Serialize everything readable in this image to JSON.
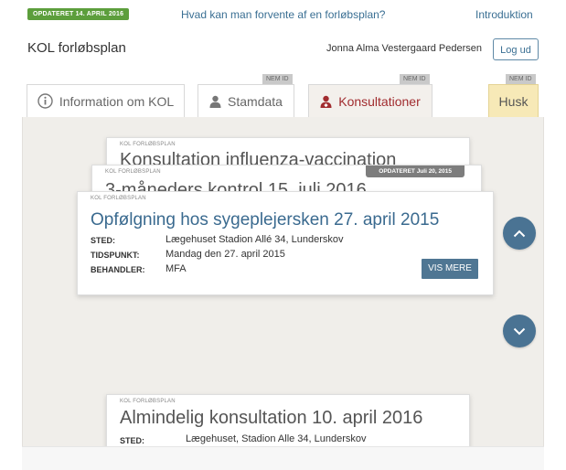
{
  "header": {
    "updated_badge": "OPDATERET 14. APRIL 2016",
    "question_link": "Hvad kan man forvente af en forløbsplan?",
    "intro_link": "Introduktion",
    "app_title": "KOL forløbsplan",
    "user_name": "Jonna Alma Vestergaard Pedersen",
    "logout_label": "Log ud"
  },
  "tabs": [
    {
      "label": "Information om KOL",
      "icon": "info-icon",
      "nemid": ""
    },
    {
      "label": "Stamdata",
      "icon": "person-icon",
      "nemid": "NEM ID"
    },
    {
      "label": "Konsultationer",
      "icon": "doctor-icon",
      "nemid": "NEM ID",
      "active": true
    },
    {
      "label": "Husk",
      "icon": "",
      "nemid": "NEM ID"
    }
  ],
  "cards": {
    "back1": {
      "tag": "KOL FORLØBSPLAN",
      "title": "Konsultation influenza-vaccination"
    },
    "back2": {
      "tag": "KOL FORLØBSPLAN",
      "title": "3-måneders kontrol 15. juli 2016",
      "updated": "OPDATERET Juli 20, 2015"
    },
    "main": {
      "tag": "KOL FORLØBSPLAN",
      "title": "Opfølgning hos sygeplejersken 27. april 2015",
      "rows": [
        {
          "label": "STED:",
          "value": "Lægehuset Stadion Allé 34, Lunderskov"
        },
        {
          "label": "TIDSPUNKT:",
          "value": "Mandag den 27. april 2015"
        },
        {
          "label": "BEHANDLER:",
          "value": "MFA"
        }
      ],
      "button": "VIS MERE"
    },
    "lower": {
      "tag": "KOL FORLØBSPLAN",
      "title": "Almindelig konsultation 10. april 2016",
      "rows": [
        {
          "label": "STED:",
          "value": "Lægehuset, Stadion Alle 34, Lunderskov"
        }
      ]
    }
  },
  "nav": {
    "up_icon": "chevron-up-icon",
    "down_icon": "chevron-down-icon"
  },
  "colors": {
    "accent": "#4a7393",
    "active_tab": "#a12c2f",
    "husk": "#f7e9b7",
    "updated_green": "#5c9e3c"
  }
}
